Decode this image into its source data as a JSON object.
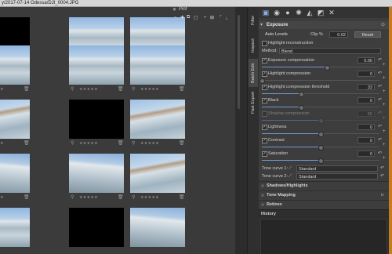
{
  "window": {
    "title": "y/2017-07-14 Odessa/DJI_0004.JPG"
  },
  "filmstrip": {
    "toolbar_label": "Pinf",
    "rows": [
      [
        {
          "kind": "black",
          "star": "★★★★★"
        },
        {
          "kind": "img",
          "star": "★★★★★"
        },
        {
          "kind": "img",
          "star": "★★★★★"
        }
      ],
      [
        {
          "kind": "img",
          "star": "★★★★★"
        },
        {
          "kind": "img",
          "star": "★★★★★"
        },
        {
          "kind": "img",
          "star": "★★★★★"
        }
      ],
      [
        {
          "kind": "img2",
          "star": "★★★★★"
        },
        {
          "kind": "black",
          "star": "★★★★★"
        },
        {
          "kind": "img2",
          "star": "★★★★★"
        }
      ],
      [
        {
          "kind": "img3",
          "star": "★★★★★"
        },
        {
          "kind": "img3",
          "star": "★★★★★"
        },
        {
          "kind": "img2",
          "star": "★★★★★"
        }
      ],
      [
        {
          "kind": "img",
          "star": ""
        },
        {
          "kind": "black",
          "star": ""
        },
        {
          "kind": "img3",
          "star": ""
        }
      ]
    ]
  },
  "side_tabs": [
    "Filter",
    "Inspect",
    "Batch Edit",
    "Fast Export"
  ],
  "panel": {
    "exposure": {
      "title": "Exposure",
      "auto_levels": "Auto Levels",
      "clip_label": "Clip %",
      "clip_value": "0.02",
      "reset": "Reset",
      "highlight_reconstruction": "Highlight reconstruction",
      "method_label": "Method:",
      "method_value": "Blend",
      "sliders": [
        {
          "label": "Exposure compensation",
          "value": "0.00",
          "pos": 0.55,
          "enabled": true
        },
        {
          "label": "Highlight compression",
          "value": "0",
          "pos": 0.0,
          "enabled": true
        },
        {
          "label": "Highlight compression threshold",
          "value": "33",
          "pos": 0.33,
          "enabled": true
        },
        {
          "label": "Black",
          "value": "0",
          "pos": 0.33,
          "enabled": true
        },
        {
          "label": "Shadow compression",
          "value": "50",
          "pos": 0.5,
          "enabled": false
        },
        {
          "label": "Lightness",
          "value": "0",
          "pos": 0.5,
          "enabled": true
        },
        {
          "label": "Contrast",
          "value": "0",
          "pos": 0.5,
          "enabled": true
        },
        {
          "label": "Saturation",
          "value": "0",
          "pos": 0.5,
          "enabled": true
        }
      ],
      "tone_curves": [
        {
          "label": "Tone curve 1:",
          "value": "Standard"
        },
        {
          "label": "Tone curve 2:",
          "value": "Standard"
        }
      ]
    },
    "collapsed_sections": [
      "Shadows/Highlights",
      "Tone Mapping",
      "Retinex"
    ],
    "history_title": "History"
  },
  "colors": {
    "accent": "#6f9ad1",
    "orange_bar": "#c77a1f"
  }
}
